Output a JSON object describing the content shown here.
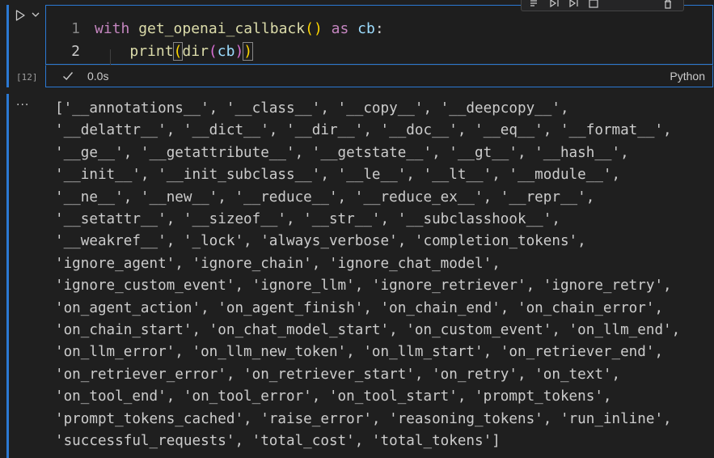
{
  "cell": {
    "execution_count": "[12]",
    "language": "Python",
    "exec_time": "0.0s",
    "code_lines": [
      {
        "number": "1"
      },
      {
        "number": "2"
      }
    ],
    "code_tokens": {
      "line1_kw_with": "with",
      "line1_fn": "get_openai_callback",
      "line1_parens": "()",
      "line1_kw_as": "as",
      "line1_var": "cb",
      "line1_colon": ":",
      "line2_fn_print": "print",
      "line2_open": "(",
      "line2_fn_dir": "dir",
      "line2_open2": "(",
      "line2_var": "cb",
      "line2_close2": ")",
      "line2_close": ")"
    }
  },
  "output": {
    "more_label": "...",
    "lines": [
      "['__annotations__', '__class__', '__copy__', '__deepcopy__',",
      "'__delattr__', '__dict__', '__dir__', '__doc__', '__eq__', '__format__',",
      "'__ge__', '__getattribute__', '__getstate__', '__gt__', '__hash__',",
      "'__init__', '__init_subclass__', '__le__', '__lt__', '__module__',",
      "'__ne__', '__new__', '__reduce__', '__reduce_ex__', '__repr__',",
      "'__setattr__', '__sizeof__', '__str__', '__subclasshook__',",
      "'__weakref__', '_lock', 'always_verbose', 'completion_tokens',",
      "'ignore_agent', 'ignore_chain', 'ignore_chat_model',",
      "'ignore_custom_event', 'ignore_llm', 'ignore_retriever', 'ignore_retry',",
      "'on_agent_action', 'on_agent_finish', 'on_chain_end', 'on_chain_error',",
      "'on_chain_start', 'on_chat_model_start', 'on_custom_event', 'on_llm_end',",
      "'on_llm_error', 'on_llm_new_token', 'on_llm_start', 'on_retriever_end',",
      "'on_retriever_error', 'on_retriever_start', 'on_retry', 'on_text',",
      "'on_tool_end', 'on_tool_error', 'on_tool_start', 'prompt_tokens',",
      "'prompt_tokens_cached', 'raise_error', 'reasoning_tokens', 'run_inline',",
      "'successful_requests', 'total_cost', 'total_tokens']"
    ]
  },
  "icons": {
    "run": "play-icon",
    "run_dropdown": "chevron-down-icon",
    "status": "check-icon",
    "output_menu": "more-icon"
  },
  "colors": {
    "accent": "#2b79d3",
    "background": "#1f1f1f",
    "keyword": "#c586c0",
    "function": "#dcdcaa",
    "variable": "#9cdcfe"
  }
}
